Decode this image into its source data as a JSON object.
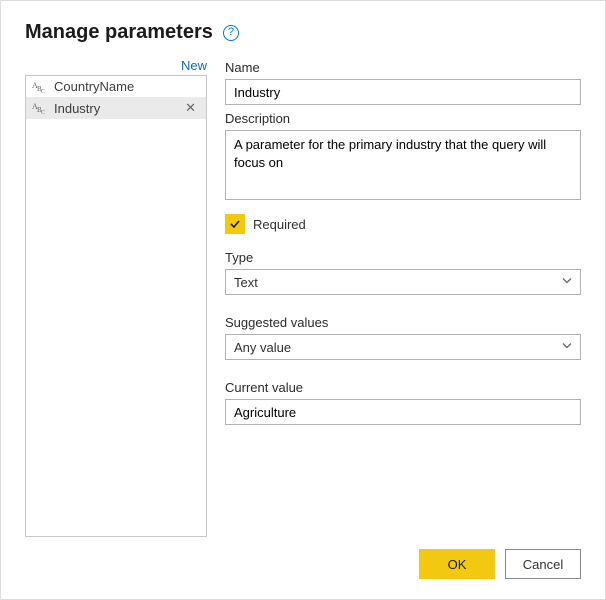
{
  "header": {
    "title": "Manage parameters"
  },
  "sidebar": {
    "new_label": "New",
    "items": [
      {
        "label": "CountryName",
        "selected": false
      },
      {
        "label": "Industry",
        "selected": true
      }
    ]
  },
  "form": {
    "name_label": "Name",
    "name_value": "Industry",
    "description_label": "Description",
    "description_value": "A parameter for the primary industry that the query will focus on",
    "required_label": "Required",
    "required_checked": true,
    "type_label": "Type",
    "type_value": "Text",
    "suggested_label": "Suggested values",
    "suggested_value": "Any value",
    "current_label": "Current value",
    "current_value": "Agriculture"
  },
  "footer": {
    "ok_label": "OK",
    "cancel_label": "Cancel"
  }
}
